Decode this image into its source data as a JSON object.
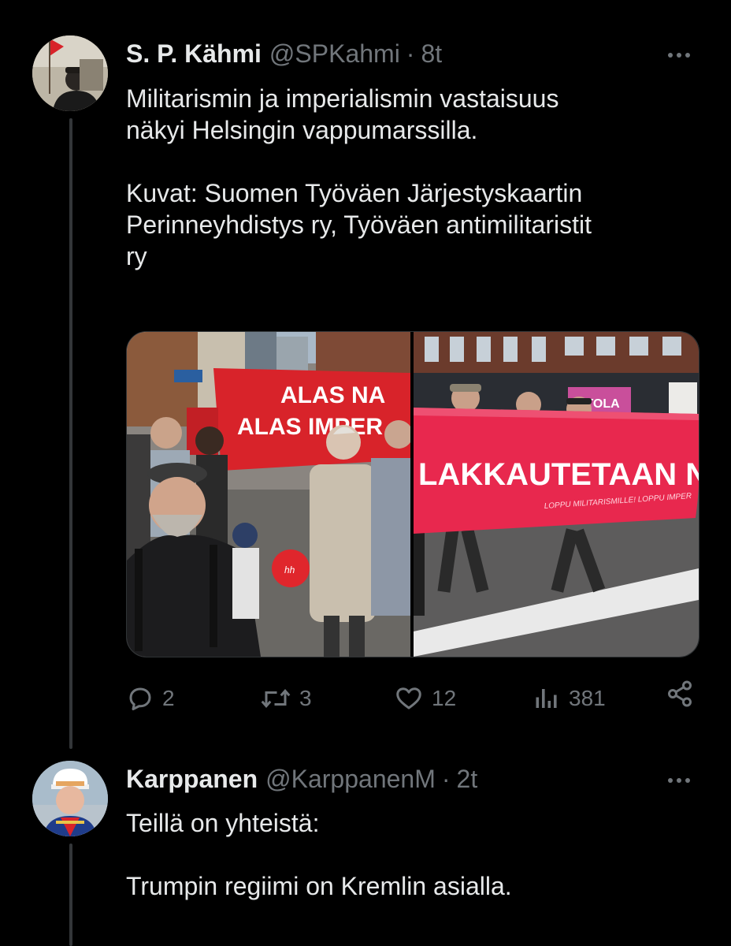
{
  "tweets": [
    {
      "name": "S. P. Kähmi",
      "handle": "@SPKahmi",
      "separator": "·",
      "time": "8t",
      "text": "Militarismin ja imperialismin vastaisuus\nnäkyi Helsingin vappumarssilla.\n\nKuvat: Suomen Työväen Järjestyskaartin\nPerinneyhdistys ry, Työväen antimilitaristit\nry",
      "media": {
        "left_banner_line1": "ALAS NA",
        "left_banner_line2": "ALAS IMPER",
        "right_banner_main": "LAKKAUTETAAN NA",
        "right_banner_sub": "LOPPU MILITARISMILLE! LOPPU IMPER",
        "store_sign": "ITOLA",
        "balloon_text": "hh"
      },
      "actions": {
        "replies": "2",
        "retweets": "3",
        "likes": "12",
        "views": "381"
      }
    },
    {
      "name": "Karppanen",
      "handle": "@KarppanenM",
      "separator": "·",
      "time": "2t",
      "text": "Teillä on yhteistä:\n\nTrumpin regiimi on Kremlin asialla."
    }
  ],
  "colors": {
    "background": "#000000",
    "text_primary": "#e7e9ea",
    "text_secondary": "#71767b",
    "thread_line": "#333639",
    "banner_red": "#d8232a"
  },
  "icons": {
    "reply": "reply-icon",
    "retweet": "retweet-icon",
    "like": "heart-icon",
    "views": "views-icon",
    "share": "share-icon",
    "more": "more-icon"
  }
}
